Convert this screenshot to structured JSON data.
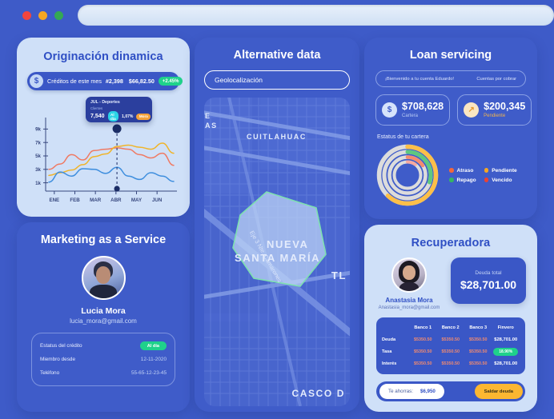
{
  "chrome": {
    "traffic_lights": [
      "close",
      "minimize",
      "maximize"
    ],
    "address_value": "",
    "address_placeholder": ""
  },
  "origination": {
    "title": "Originación dinamica",
    "banner": {
      "icon": "dollar-icon",
      "label": "Créditos de este mes",
      "count": "#2,398",
      "amount": "$66,82.50",
      "badge": "+2.45%",
      "badge_color": "#1fd18b"
    },
    "tooltip": {
      "title": "JUL - Deportes",
      "subtitle": "Clientes",
      "value": "7,540",
      "chip_ok": "Al día",
      "percent": "1,07%",
      "chip_bad": "Mora"
    }
  },
  "marketing": {
    "title": "Marketing as a Service",
    "name": "Lucia Mora",
    "email": "lucia_mora@gmail.com",
    "rows": [
      {
        "key": "Estatus del crédito",
        "value": "Al día",
        "is_badge": true
      },
      {
        "key": "Miembro desde",
        "value": "12-11-2020",
        "is_badge": false
      },
      {
        "key": "Teléfono",
        "value": "55-65-12-23-45",
        "is_badge": false
      }
    ]
  },
  "alternative": {
    "title": "Alternative data",
    "filter": "Geolocalización",
    "map_labels": [
      {
        "text": "CUITLAHUAC",
        "size": 9
      },
      {
        "text": "NUEVA",
        "size": 13
      },
      {
        "text": "SANTA MARÍA",
        "size": 13
      },
      {
        "text": "TL",
        "size": 13
      },
      {
        "text": "CASCO D",
        "size": 12
      },
      {
        "text": "E",
        "size": 9
      },
      {
        "text": "AS",
        "size": 9
      },
      {
        "text": "Eje 3 Nte. Camarones",
        "size": 8
      }
    ]
  },
  "loan": {
    "title": "Loan servicing",
    "welcome": "¡Bienvenido a tu cuenta Eduardo!",
    "subtitle": "Cuentas por cobrar",
    "stats": [
      {
        "icon": "dollar-icon",
        "value": "$708,628",
        "label": "Cartera"
      },
      {
        "icon": "arrow-up-right-icon",
        "value": "$200,345",
        "label": "Pendiente"
      }
    ],
    "donut_title": "Estatus de tu cartera",
    "legend": [
      {
        "label": "Atraso",
        "color": "#f2683c"
      },
      {
        "label": "Pendiente",
        "color": "#f5a623"
      },
      {
        "label": "Repago",
        "color": "#35b563"
      },
      {
        "label": "Vencido",
        "color": "#ea4335"
      }
    ]
  },
  "recuperadora": {
    "title": "Recuperadora",
    "name": "Anastasia Mora",
    "email": "Anastasia_mora@gmail.com",
    "debt_label": "Deuda total",
    "debt_value": "$28,701.00",
    "table": {
      "headers": [
        "",
        "Banco 1",
        "Banco 2",
        "Banco 3",
        "Finvero"
      ],
      "rows": [
        {
          "key": "Deuda",
          "c1": "$5350.50",
          "c2": "$5350.50",
          "c3": "$5350.50",
          "finvero": "$28,701.00",
          "finvero_badge": false
        },
        {
          "key": "Tasa",
          "c1": "$5350.50",
          "c2": "$5350.50",
          "c3": "$5350.50",
          "finvero": "18.90%",
          "finvero_badge": true
        },
        {
          "key": "Interés",
          "c1": "$5350.50",
          "c2": "$5350.50",
          "c3": "$5350.50",
          "finvero": "$28,701.00",
          "finvero_badge": false
        }
      ]
    },
    "savings_label": "Te ahorras:",
    "savings_value": "$6,950",
    "cta": "Saldar deuda"
  },
  "chart_data": {
    "type": "line",
    "title": "Originación dinamica",
    "xlabel": "",
    "ylabel": "",
    "categories": [
      "ENE",
      "FEB",
      "MAR",
      "ABR",
      "MAY",
      "JUN"
    ],
    "yticks": [
      "1k",
      "3k",
      "5k",
      "7k",
      "9k"
    ],
    "ylim": [
      0,
      10000
    ],
    "grid": false,
    "legend_position": "none",
    "highlight_x": "ABR",
    "series": [
      {
        "name": "Atraso",
        "color": "#ef7a63",
        "values": [
          3000,
          3800,
          5200,
          4400,
          5800,
          6000,
          6200,
          6000,
          5200,
          4700,
          5400,
          3600
        ]
      },
      {
        "name": "Pendiente",
        "color": "#f0b429",
        "values": [
          2100,
          2500,
          2900,
          3700,
          4900,
          5300,
          6400,
          6600,
          6300,
          6000,
          6900,
          5400
        ]
      },
      {
        "name": "Repago",
        "color": "#3e8ede",
        "values": [
          1100,
          2600,
          2000,
          3100,
          3000,
          2400,
          3300,
          2000,
          1500,
          2500,
          2000,
          1200
        ]
      }
    ],
    "donut": {
      "type": "pie",
      "title": "Estatus de tu cartera",
      "rings": [
        {
          "name": "Pendiente",
          "color": "#fcbf49",
          "value": 62,
          "track": "#dcdcdc"
        },
        {
          "name": "Repago",
          "color": "#5fc87f",
          "value": 30,
          "track": "#dcdcdc"
        },
        {
          "name": "Atraso",
          "color": "#f58b6e",
          "value": 16,
          "track": "#dcdcdc"
        },
        {
          "name": "Vencido",
          "color": "#f6a9a0",
          "value": 10,
          "track": "#dcdcdc"
        }
      ]
    }
  }
}
